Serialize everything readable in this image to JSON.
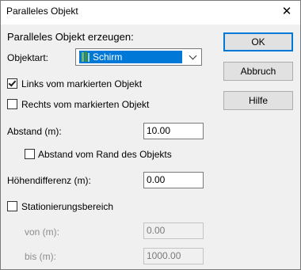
{
  "window": {
    "title": "Paralleles Objekt",
    "close_glyph": "✕"
  },
  "section_title": "Paralleles Objekt erzeugen:",
  "objektart": {
    "label": "Objektart:",
    "selected": "Schirm",
    "icon": "schirm-icon"
  },
  "links": {
    "label": "Links vom markierten Objekt",
    "checked": true
  },
  "rechts": {
    "label": "Rechts vom markierten Objekt",
    "checked": false
  },
  "abstand": {
    "label": "Abstand (m):",
    "value": "10.00"
  },
  "abstand_rand": {
    "label": "Abstand vom Rand des Objekts",
    "checked": false
  },
  "hoehendifferenz": {
    "label": "Höhendifferenz (m):",
    "value": "0.00"
  },
  "stationierung": {
    "label": "Stationierungsbereich",
    "checked": false
  },
  "von": {
    "label": "von (m):",
    "value": "0.00"
  },
  "bis": {
    "label": "bis (m):",
    "value": "1000.00"
  },
  "buttons": {
    "ok": "OK",
    "abbruch": "Abbruch",
    "hilfe": "Hilfe"
  },
  "colors": {
    "accent": "#0078d7",
    "disabled_text": "#8d8d8d"
  }
}
